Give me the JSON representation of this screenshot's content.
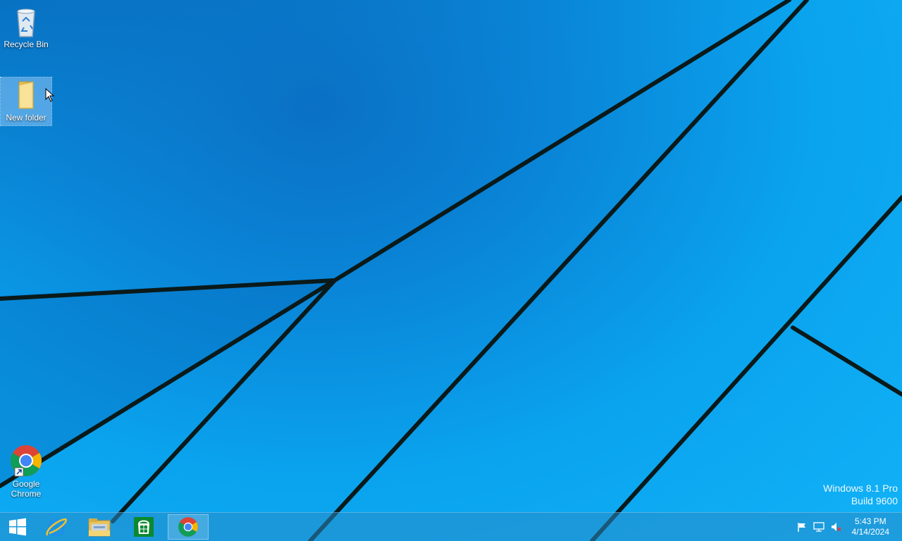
{
  "desktop": {
    "icons": [
      {
        "label": "Recycle Bin",
        "icon": "recycle-bin-icon"
      },
      {
        "label": "New folder",
        "icon": "folder-icon",
        "selected": true
      },
      {
        "label": "Google Chrome",
        "icon": "chrome-icon"
      }
    ],
    "watermark": {
      "line1": "Windows 8.1 Pro",
      "line2": "Build 9600"
    }
  },
  "taskbar": {
    "pinned": [
      {
        "name": "internet-explorer",
        "icon": "internet-explorer-icon"
      },
      {
        "name": "file-explorer",
        "icon": "file-explorer-icon"
      },
      {
        "name": "store",
        "icon": "store-icon"
      },
      {
        "name": "google-chrome",
        "icon": "chrome-icon",
        "active": true
      }
    ],
    "tray": {
      "icons": [
        "action-center-flag-icon",
        "network-icon",
        "volume-muted-icon"
      ],
      "time": "5:43 PM",
      "date": "4/14/2024"
    }
  },
  "colors": {
    "wallpaper": "#0aa3ee",
    "taskbar": "#288cc8"
  }
}
